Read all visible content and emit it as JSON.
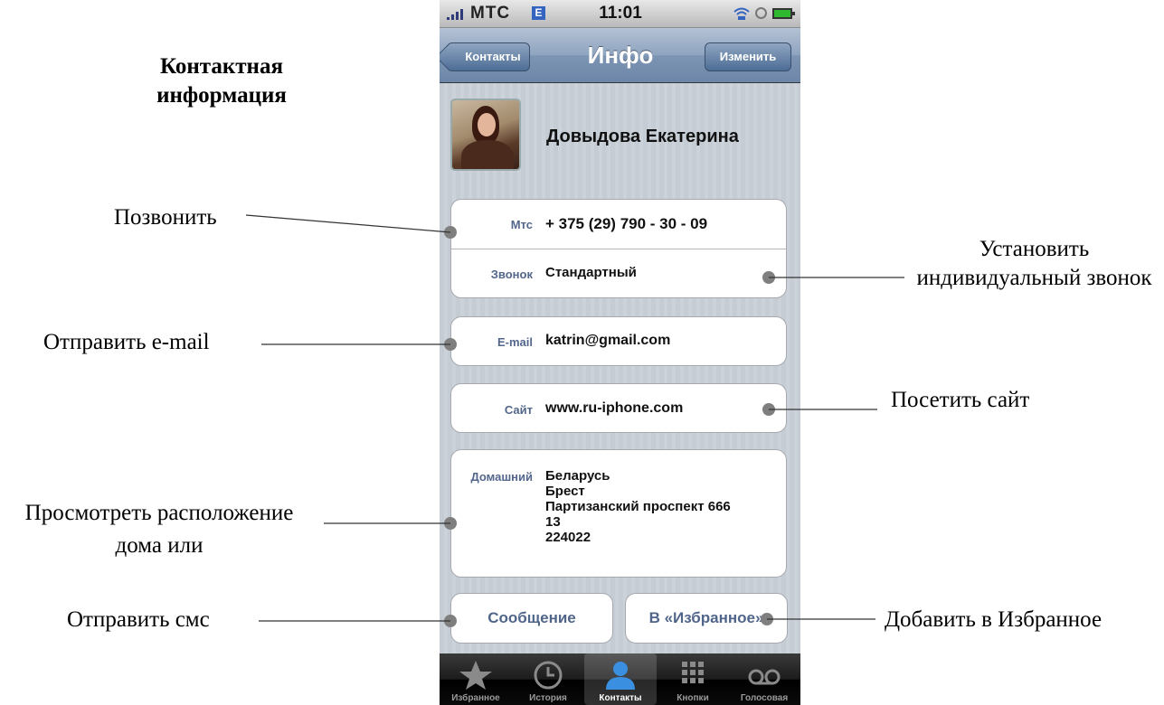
{
  "page": {
    "title": "Контактная информация"
  },
  "annotations": {
    "call": "Позвонить",
    "ringtone": "Установить индивидуальный звонок",
    "email": "Отправить e-mail",
    "site": "Посетить сайт",
    "map": "Просмотреть расположение дома или",
    "sms": "Отправить смс",
    "favorite": "Добавить в Избранное"
  },
  "status_bar": {
    "carrier": "МТС",
    "network": "E",
    "time": "11:01"
  },
  "nav": {
    "back_label": "Контакты",
    "title": "Инфо",
    "edit_label": "Изменить"
  },
  "contact": {
    "name": "Довыдова Екатерина",
    "phone_label": "Мтс",
    "phone": "+ 375 (29) 790 - 30 - 09",
    "ringtone_label": "Звонок",
    "ringtone": "Стандартный",
    "email_label": "E-mail",
    "email": "katrin@gmail.com",
    "site_label": "Сайт",
    "site": "www.ru-iphone.com",
    "address_label": "Домашний",
    "address_lines": [
      "Беларусь",
      "Брест",
      "Партизанский проспект 666",
      "13",
      "224022"
    ]
  },
  "actions": {
    "message": "Сообщение",
    "favorite": "В «Избранное»"
  },
  "tabs": [
    {
      "label": "Избранное",
      "icon": "star-icon"
    },
    {
      "label": "История",
      "icon": "clock-icon"
    },
    {
      "label": "Контакты",
      "icon": "person-icon",
      "selected": true
    },
    {
      "label": "Кнопки",
      "icon": "keypad-icon"
    },
    {
      "label": "Голосовая",
      "icon": "voicemail-icon"
    }
  ],
  "colors": {
    "label_blue": "#53668b",
    "nav_blue": "#6d86a8",
    "tab_bg": "#000000",
    "dot": "#7f7f7f"
  }
}
